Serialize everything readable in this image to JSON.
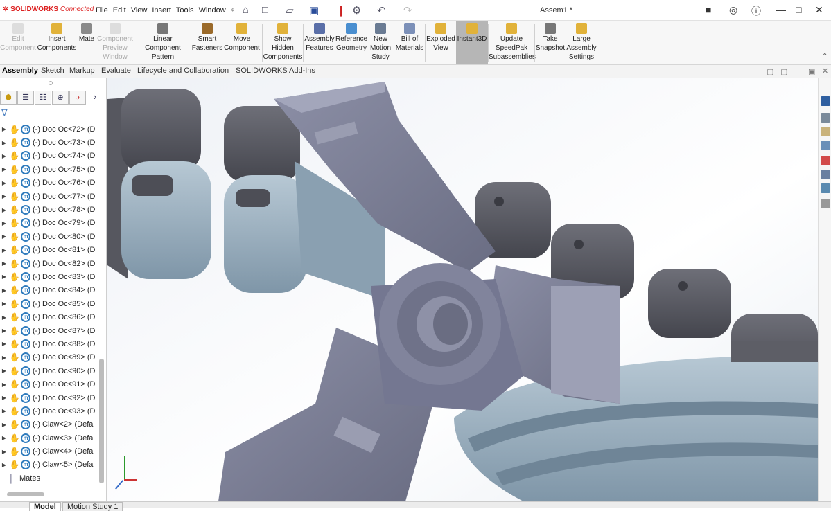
{
  "app": {
    "logo": "SOLIDWORKS",
    "logo_suffix": "Connected",
    "document_title": "Assem1 *"
  },
  "menu": [
    "File",
    "Edit",
    "View",
    "Insert",
    "Tools",
    "Window"
  ],
  "ribbon": [
    {
      "label": "Edit\nComponent",
      "disabled": true,
      "icon": "edit-component-icon"
    },
    {
      "label": "Insert\nComponents",
      "disabled": false,
      "icon": "insert-components-icon"
    },
    {
      "label": "Mate",
      "disabled": false,
      "icon": "mate-icon"
    },
    {
      "label": "Component\nPreview\nWindow",
      "disabled": true,
      "icon": "component-preview-icon"
    },
    {
      "label": "Linear Component\nPattern",
      "disabled": false,
      "icon": "linear-pattern-icon"
    },
    {
      "label": "Smart\nFasteners",
      "disabled": false,
      "icon": "smart-fasteners-icon"
    },
    {
      "label": "Move\nComponent",
      "disabled": false,
      "icon": "move-component-icon"
    },
    {
      "label": "Show\nHidden\nComponents",
      "disabled": false,
      "icon": "show-hidden-icon"
    },
    {
      "label": "Assembly\nFeatures",
      "disabled": false,
      "icon": "assembly-features-icon"
    },
    {
      "label": "Reference\nGeometry",
      "disabled": false,
      "icon": "reference-geometry-icon"
    },
    {
      "label": "New\nMotion\nStudy",
      "disabled": false,
      "icon": "motion-study-icon"
    },
    {
      "label": "Bill of\nMaterials",
      "disabled": false,
      "icon": "bill-of-materials-icon"
    },
    {
      "label": "Exploded\nView",
      "disabled": false,
      "icon": "exploded-view-icon"
    },
    {
      "label": "Instant3D",
      "disabled": false,
      "active": true,
      "icon": "instant3d-icon"
    },
    {
      "label": "Update\nSpeedPak\nSubassemblies",
      "disabled": false,
      "icon": "speedpak-icon"
    },
    {
      "label": "Take\nSnapshot",
      "disabled": false,
      "icon": "snapshot-icon"
    },
    {
      "label": "Large\nAssembly\nSettings",
      "disabled": false,
      "icon": "large-assembly-icon"
    }
  ],
  "tabs": [
    "Assembly",
    "Sketch",
    "Markup",
    "Evaluate",
    "Lifecycle and Collaboration",
    "SOLIDWORKS Add-Ins"
  ],
  "active_tab": "Assembly",
  "tree": [
    "(-) Doc Oc<72> (D",
    "(-) Doc Oc<73> (D",
    "(-) Doc Oc<74> (D",
    "(-) Doc Oc<75> (D",
    "(-) Doc Oc<76> (D",
    "(-) Doc Oc<77> (D",
    "(-) Doc Oc<78> (D",
    "(-) Doc Oc<79> (D",
    "(-) Doc Oc<80> (D",
    "(-) Doc Oc<81> (D",
    "(-) Doc Oc<82> (D",
    "(-) Doc Oc<83> (D",
    "(-) Doc Oc<84> (D",
    "(-) Doc Oc<85> (D",
    "(-) Doc Oc<86> (D",
    "(-) Doc Oc<87> (D",
    "(-) Doc Oc<88> (D",
    "(-) Doc Oc<89> (D",
    "(-) Doc Oc<90> (D",
    "(-) Doc Oc<91> (D",
    "(-) Doc Oc<92> (D",
    "(-) Doc Oc<93> (D",
    "(-) Claw<2> (Defa",
    "(-) Claw<3> (Defa",
    "(-) Claw<4> (Defa",
    "(-) Claw<5> (Defa"
  ],
  "mates_label": "Mates",
  "bottom_tabs": [
    "Model",
    "Motion Study 1"
  ],
  "colors": {
    "accent": "#2f7bbd",
    "hand": "#c89a10",
    "part_dark": "#5c5d66",
    "part_blue": "#9db0bf",
    "claw": "#7b7e94"
  }
}
